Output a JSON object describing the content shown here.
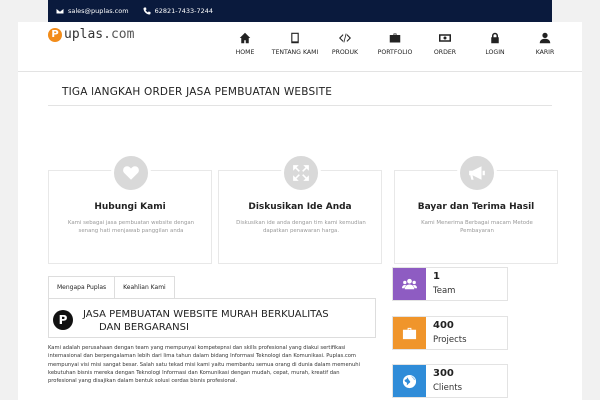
{
  "topbar": {
    "email": "sales@puplas.com",
    "phone": "62821-7433-7244"
  },
  "logo": {
    "mark": "P",
    "name": "uplas",
    "domain": ".com"
  },
  "nav": [
    {
      "label": "HOME",
      "icon": "home-icon"
    },
    {
      "label": "TENTANG KAMI",
      "icon": "tablet-icon"
    },
    {
      "label": "PRODUK",
      "icon": "code-icon"
    },
    {
      "label": "PORTFOLIO",
      "icon": "briefcase-icon"
    },
    {
      "label": "ORDER",
      "icon": "money-icon"
    },
    {
      "label": "LOGIN",
      "icon": "lock-icon"
    },
    {
      "label": "KARIR",
      "icon": "user-icon"
    }
  ],
  "section_title": "TIGA lANGKAH ORDER JASA PEMBUATAN WEBSITE",
  "cards": [
    {
      "title": "Hubungi Kami",
      "desc": "Kami sebagai jasa pembuatan website dengan senang hati menjawab panggilan anda",
      "icon": "heart-icon"
    },
    {
      "title": "Diskusikan Ide Anda",
      "desc": "Diskusikan ide anda dengan tim kami kemudian dapatkan penawaran harga.",
      "icon": "expand-icon"
    },
    {
      "title": "Bayar dan Terima Hasil",
      "desc": "Kami Menerima Berbagai macam Metode Pembayaran",
      "icon": "megaphone-icon"
    }
  ],
  "tabs": [
    {
      "label": "Mengapa Puplas"
    },
    {
      "label": "Keahlian Kami"
    }
  ],
  "tab_content": {
    "badge": "P",
    "heading_line1": "JASA PEMBUATAN WEBSITE MURAH BERKUALITAS",
    "heading_line2": "DAN BERGARANSI",
    "about": "Kami adalah perusahaan dengan team yang mempunyai kompetepnsi dan skills profesional yang diakui sertifikasi internasional dan berpengalaman lebih dari lima tahun dalam bidang Informasi Teknologi dan Komunikasi. Puplas.com mempunyai visi misi sangat besar. Salah satu tekad misi kami yaitu membantu semua orang di dunia dalam memenuhi kebutuhan bisnis mereka dengan Teknologi Informasi dan Komunikasi dengan mudah, cepat, murah, kreatif dan profesional yang disajikan dalam bentuk solusi cerdas bisnis profesional."
  },
  "stats": [
    {
      "number": "1",
      "label": "Team",
      "color": "#8e5cc2",
      "icon": "users-icon"
    },
    {
      "number": "400",
      "label": "Projects",
      "color": "#f0952b",
      "icon": "briefcase-icon"
    },
    {
      "number": "300",
      "label": "Clients",
      "color": "#2f8cd8",
      "icon": "globe-icon"
    }
  ]
}
